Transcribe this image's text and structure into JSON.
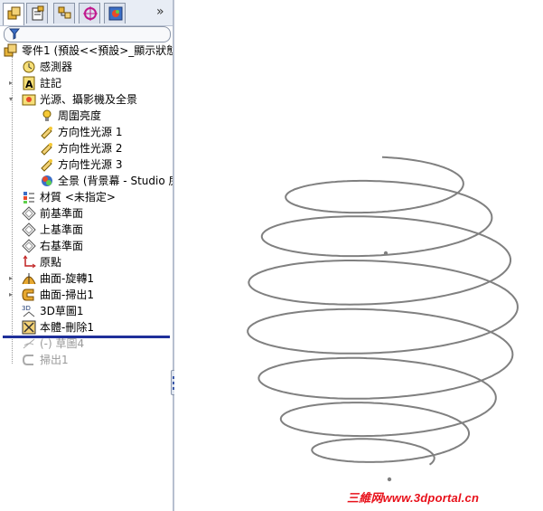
{
  "tabs": [
    {
      "name": "FeatureManager",
      "icon": "feature-tree-icon"
    },
    {
      "name": "PropertyManager",
      "icon": "property-manager-icon"
    },
    {
      "name": "ConfigurationManager",
      "icon": "configuration-icon"
    },
    {
      "name": "DimXpertManager",
      "icon": "dimxpert-icon"
    },
    {
      "name": "DisplayManager",
      "icon": "display-manager-icon"
    }
  ],
  "expand_glyph": "»",
  "tree": {
    "root": "零件1  (預設<<預設>_顯示狀態",
    "items": [
      {
        "label": "感測器",
        "icon": "sensor-icon"
      },
      {
        "label": "註記",
        "icon": "annotation-icon"
      },
      {
        "label": "光源、攝影機及全景",
        "icon": "lights-cameras-icon"
      },
      {
        "label": "周圍亮度",
        "icon": "ambient-light-icon"
      },
      {
        "label": "方向性光源 1",
        "icon": "directional-light-icon"
      },
      {
        "label": "方向性光源 2",
        "icon": "directional-light-icon"
      },
      {
        "label": "方向性光源 3",
        "icon": "directional-light-icon"
      },
      {
        "label": "全景 (背景幕 - Studio 房間",
        "icon": "scene-icon"
      },
      {
        "label": "材質 <未指定>",
        "icon": "material-icon"
      },
      {
        "label": "前基準面",
        "icon": "plane-icon"
      },
      {
        "label": "上基準面",
        "icon": "plane-icon"
      },
      {
        "label": "右基準面",
        "icon": "plane-icon"
      },
      {
        "label": "原點",
        "icon": "origin-icon"
      },
      {
        "label": "曲面-旋轉1",
        "icon": "revolve-surface-icon"
      },
      {
        "label": "曲面-掃出1",
        "icon": "sweep-surface-icon"
      },
      {
        "label": "3D草圖1",
        "icon": "3d-sketch-icon"
      },
      {
        "label": "本體-刪除1",
        "icon": "delete-body-icon"
      },
      {
        "label": "(-) 草圖4",
        "icon": "sketch-icon"
      },
      {
        "label": "掃出1",
        "icon": "sweep-icon"
      }
    ]
  },
  "watermark": "三維网www.3dportal.cn",
  "colors": {
    "helix": "#808080",
    "rollback": "#1e2f9a",
    "watermark": "#e8101a"
  }
}
